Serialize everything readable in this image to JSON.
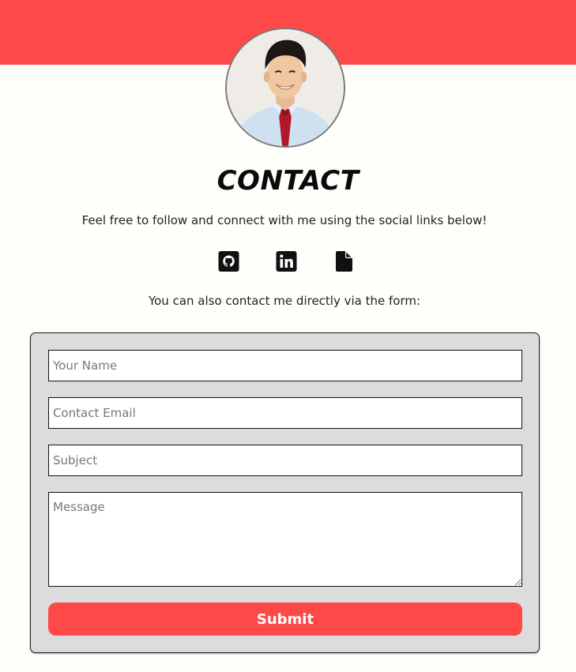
{
  "header": {
    "banner_color": "#ff4949",
    "avatar_icon": "profile-photo"
  },
  "contact": {
    "title": "CONTACT",
    "intro": "Feel free to follow and connect with me using the social links below!",
    "social_links": [
      {
        "name": "github",
        "icon": "github-icon"
      },
      {
        "name": "linkedin",
        "icon": "linkedin-icon"
      },
      {
        "name": "resume",
        "icon": "document-icon"
      }
    ],
    "form_note": "You can also contact me directly via the form:"
  },
  "form": {
    "name_placeholder": "Your Name",
    "email_placeholder": "Contact Email",
    "subject_placeholder": "Subject",
    "message_placeholder": "Message",
    "submit_label": "Submit",
    "background_color": "#dcdcdc",
    "accent_color": "#ff4949"
  }
}
